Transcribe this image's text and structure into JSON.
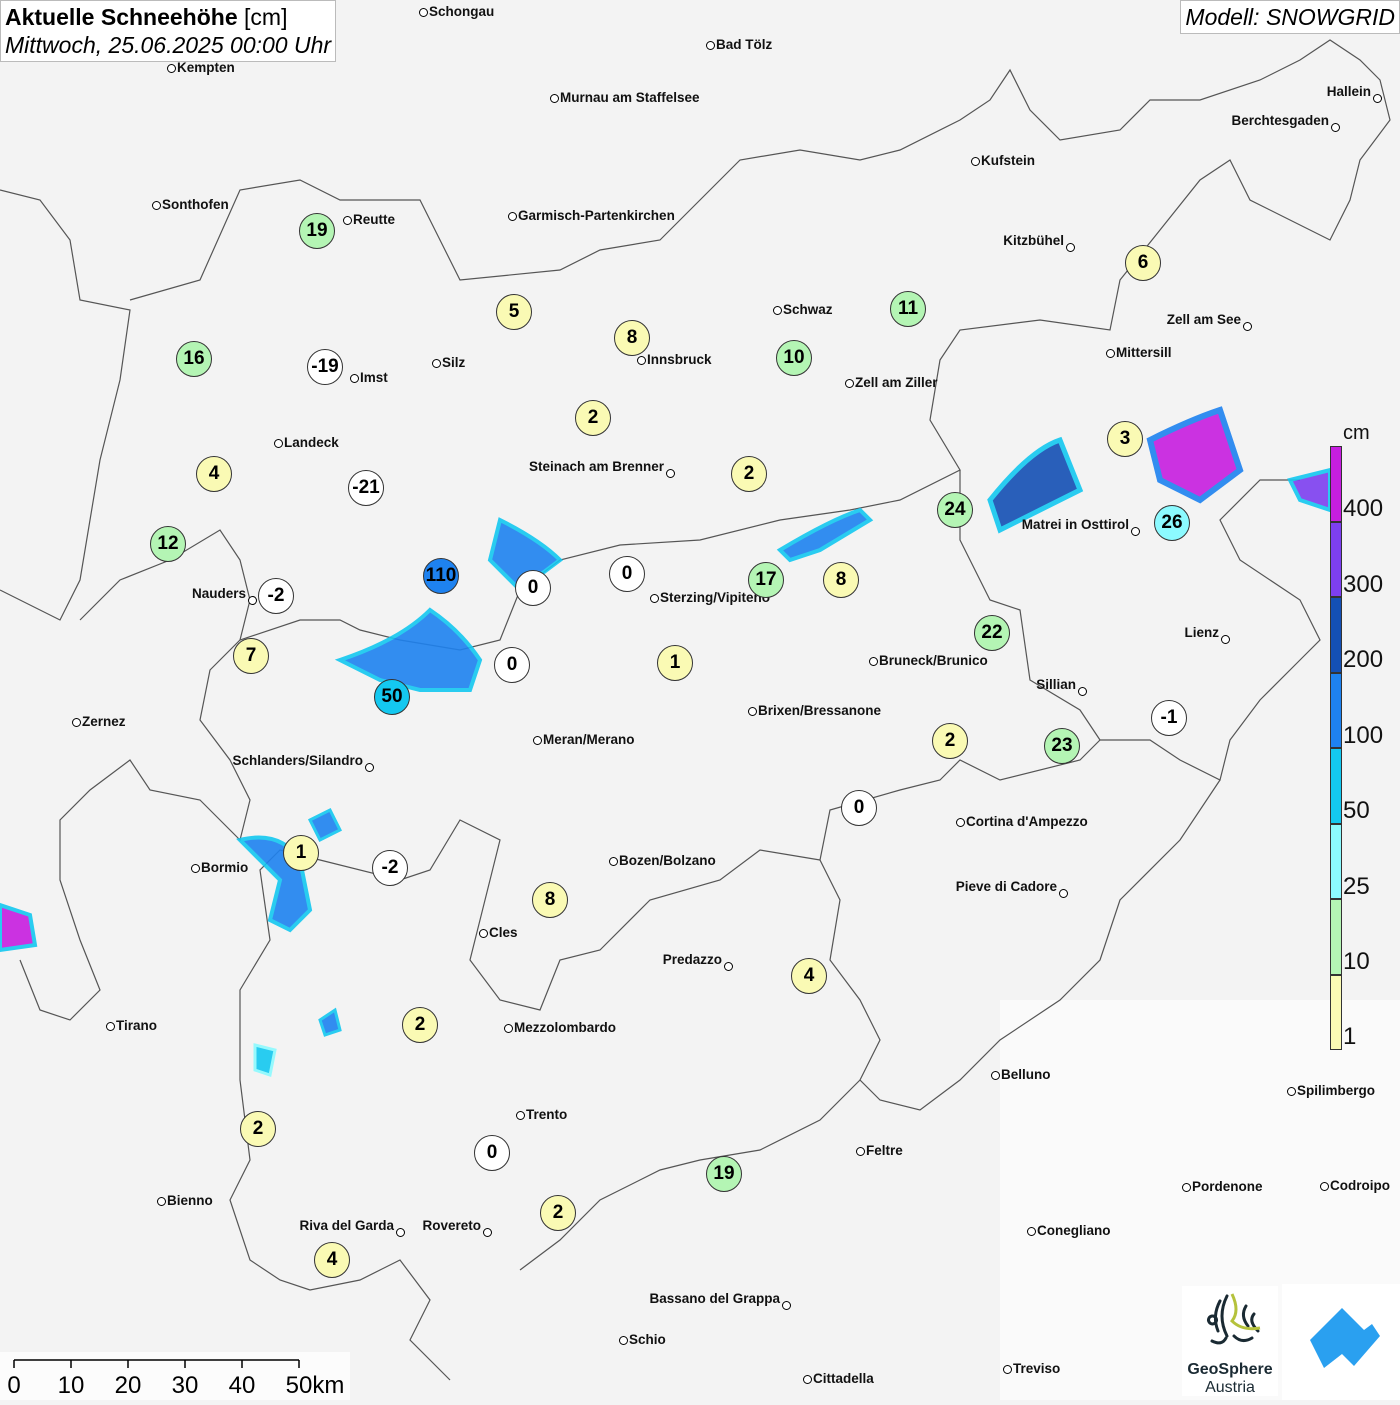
{
  "title": {
    "main": "Aktuelle Schneehöhe",
    "unit": "[cm]",
    "datetime": "Mittwoch, 25.06.2025 00:00 Uhr"
  },
  "model": "Modell: SNOWGRID",
  "legend": {
    "unit": "cm",
    "labels": [
      "400",
      "300",
      "200",
      "100",
      "50",
      "25",
      "10",
      "1"
    ],
    "colors": [
      "#c71ee0",
      "#7d3ff0",
      "#1450b4",
      "#1e82f0",
      "#14c8f0",
      "#8cfaff",
      "#b4f5b4",
      "#fafab4"
    ]
  },
  "value_colors": {
    "negative_or_zero": "#ffffff",
    "1-10": "#fafab4",
    "10-25": "#b4f5b4",
    "25-50": "#8cfaff",
    "50-100": "#14c8f0",
    "100-200": "#1e82f0"
  },
  "cities": [
    "Schongau",
    "Bad Tölz",
    "Kempten",
    "Murnau am Staffelsee",
    "Hallein",
    "Berchtesgaden",
    "Kufstein",
    "Sonthofen",
    "Reutte",
    "Garmisch-Partenkirchen",
    "Kitzbühel",
    "Schwaz",
    "Zell am See",
    "Innsbruck",
    "Silz",
    "Imst",
    "Mittersill",
    "Zell am Ziller",
    "Landeck",
    "Steinach am Brenner",
    "Matrei in Osttirol",
    "Nauders",
    "Sterzing/Vipiteno",
    "Lienz",
    "Bruneck/Brunico",
    "Sillian",
    "Brixen/Bressanone",
    "Zernez",
    "Meran/Merano",
    "Schlanders/Silandro",
    "Cortina d'Ampezzo",
    "Bozen/Bolzano",
    "Bormio",
    "Pieve di Cadore",
    "Cles",
    "Predazzo",
    "Tirano",
    "Mezzolombardo",
    "Belluno",
    "Spilimbergo",
    "Trento",
    "Feltre",
    "Pordenone",
    "Codroipo",
    "Bienno",
    "Riva del Garda",
    "Rovereto",
    "Conegliano",
    "Bassano del Grappa",
    "Schio",
    "Treviso",
    "Cittadella"
  ],
  "station_values": [
    19,
    5,
    8,
    10,
    11,
    6,
    16,
    -19,
    2,
    3,
    4,
    -21,
    2,
    24,
    26,
    12,
    110,
    0,
    0,
    17,
    8,
    -2,
    22,
    7,
    0,
    1,
    50,
    -1,
    2,
    23,
    0,
    1,
    -2,
    8,
    4,
    2,
    2,
    0,
    19,
    2,
    4
  ],
  "scale_bar": {
    "labels": [
      "0",
      "10",
      "20",
      "30",
      "40",
      "50km"
    ]
  },
  "logos": {
    "geosphere": "GeoSphere",
    "geosphere_sub": "Austria"
  }
}
